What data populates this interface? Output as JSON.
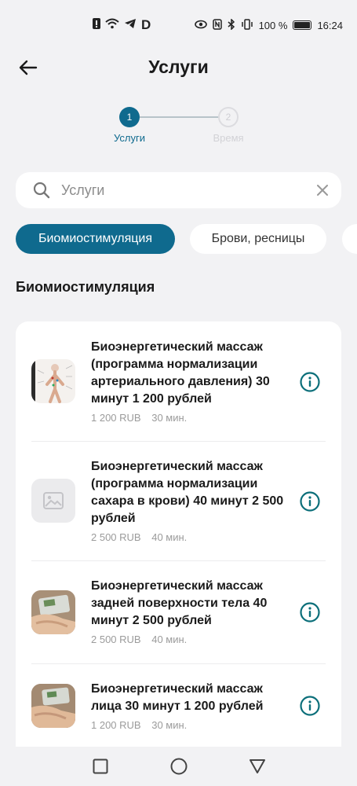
{
  "status_bar": {
    "battery": "100 %",
    "time": "16:24"
  },
  "header": {
    "title": "Услуги"
  },
  "stepper": {
    "steps": [
      {
        "number": "1",
        "label": "Услуги"
      },
      {
        "number": "2",
        "label": "Время"
      }
    ]
  },
  "search": {
    "placeholder": "Услуги",
    "value": ""
  },
  "chips": [
    {
      "label": "Биомиостимуляция"
    },
    {
      "label": "Брови, ресницы"
    },
    {
      "label": ""
    }
  ],
  "section": {
    "title": "Биомиостимуляция"
  },
  "services": [
    {
      "name": "Биоэнергетический массаж (программа нормализации артериального давления) 30 минут 1 200 рублей",
      "price": "1 200 RUB",
      "duration": "30 мин.",
      "thumb": "body-diagram-image"
    },
    {
      "name": "Биоэнергетический массаж (программа нормализации сахара в крови) 40 минут 2 500 рублей",
      "price": "2 500 RUB",
      "duration": "40 мин.",
      "thumb": "image-placeholder-icon"
    },
    {
      "name": "Биоэнергетический массаж задней поверхности тела 40 минут 2 500 рублей",
      "price": "2 500 RUB",
      "duration": "40 мин.",
      "thumb": "massage-device-photo"
    },
    {
      "name": "Биоэнергетический массаж лица 30 минут 1 200 рублей",
      "price": "1 200 RUB",
      "duration": "30 мин.",
      "thumb": "massage-device-photo"
    }
  ],
  "colors": {
    "accent": "#0f6a8e",
    "background": "#f2f2f4",
    "info_icon": "#0c6f7a"
  }
}
